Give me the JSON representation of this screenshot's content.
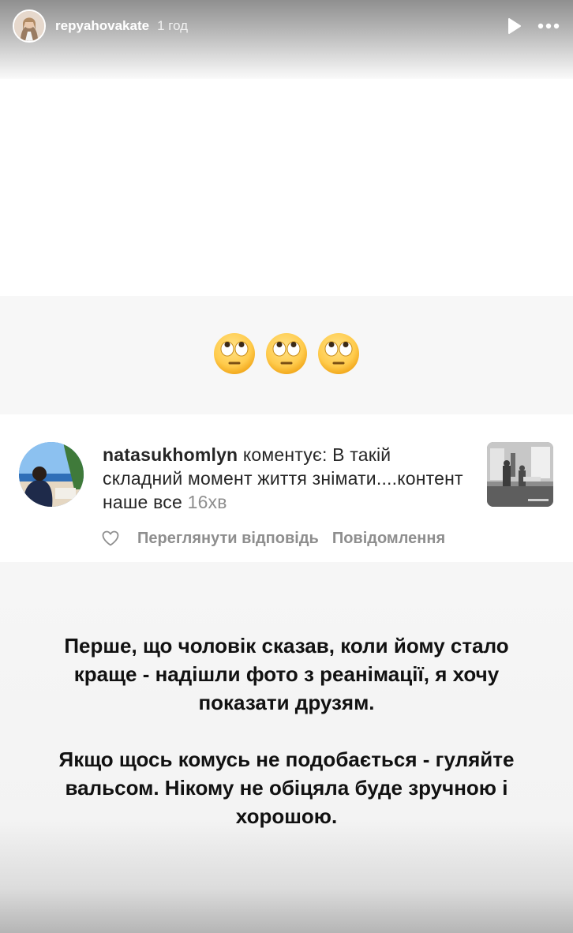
{
  "header": {
    "username": "repyahovakate",
    "time": "1 год"
  },
  "emojis": [
    "face-with-rolling-eyes",
    "face-with-rolling-eyes",
    "face-with-rolling-eyes"
  ],
  "comment": {
    "username": "natasukhomlyn",
    "text": "коментує: В такій складний момент життя знімати....контент наше все",
    "time": "16хв",
    "actions": {
      "view_replies": "Переглянути відповідь",
      "message": "Повідомлення"
    }
  },
  "story": {
    "paragraph1": "Перше, що чоловік сказав, коли йому стало краще - надішли фото з реанімації, я хочу показати друзям.",
    "paragraph2": "Якщо щось комусь не подобається - гуляйте вальсом. Нікому не обіцяла буде зручною і хорошою."
  }
}
